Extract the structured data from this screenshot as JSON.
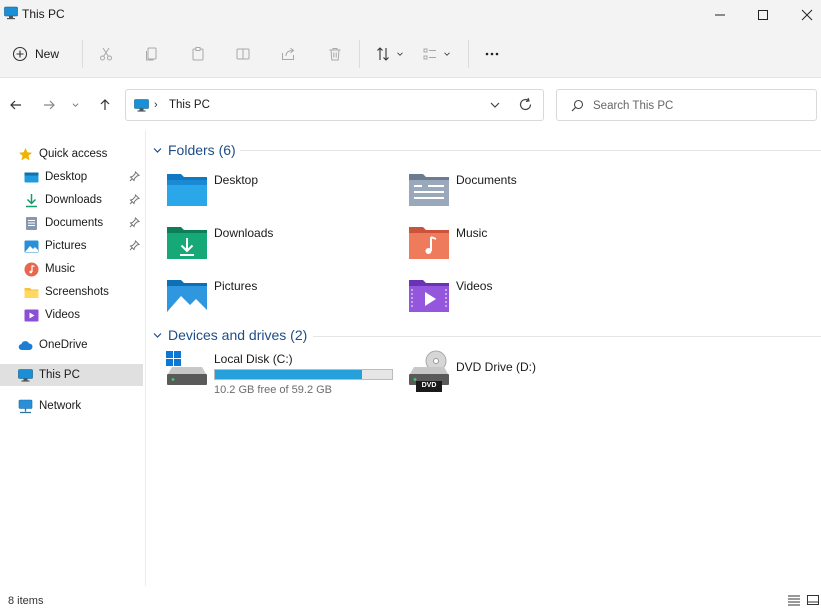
{
  "window": {
    "title": "This PC"
  },
  "toolbar": {
    "new_label": "New"
  },
  "address": {
    "path": "This PC"
  },
  "search": {
    "placeholder": "Search This PC"
  },
  "sidebar": {
    "items": [
      {
        "label": "Quick access",
        "icon": "star-icon"
      },
      {
        "label": "Desktop",
        "icon": "desktop-icon",
        "pinned": true
      },
      {
        "label": "Downloads",
        "icon": "download-icon",
        "pinned": true
      },
      {
        "label": "Documents",
        "icon": "documents-icon",
        "pinned": true
      },
      {
        "label": "Pictures",
        "icon": "pictures-icon",
        "pinned": true
      },
      {
        "label": "Music",
        "icon": "music-icon"
      },
      {
        "label": "Screenshots",
        "icon": "folder-icon"
      },
      {
        "label": "Videos",
        "icon": "videos-icon"
      },
      {
        "label": "OneDrive",
        "icon": "cloud-icon"
      },
      {
        "label": "This PC",
        "icon": "computer-icon",
        "selected": true
      },
      {
        "label": "Network",
        "icon": "network-icon"
      }
    ]
  },
  "content": {
    "folders_header": "Folders (6)",
    "folders": [
      {
        "label": "Desktop"
      },
      {
        "label": "Documents"
      },
      {
        "label": "Downloads"
      },
      {
        "label": "Music"
      },
      {
        "label": "Pictures"
      },
      {
        "label": "Videos"
      }
    ],
    "drives_header": "Devices and drives (2)",
    "drives": [
      {
        "name": "Local Disk (C:)",
        "free_text": "10.2 GB free of 59.2 GB",
        "used_fraction": 0.83
      },
      {
        "name": "DVD Drive (D:)",
        "badge": "DVD"
      }
    ]
  },
  "status": {
    "item_count": "8 items"
  },
  "colors": {
    "accent": "#26a0da",
    "header_text": "#1e4e86",
    "selected_bg": "#e0e0e0"
  }
}
